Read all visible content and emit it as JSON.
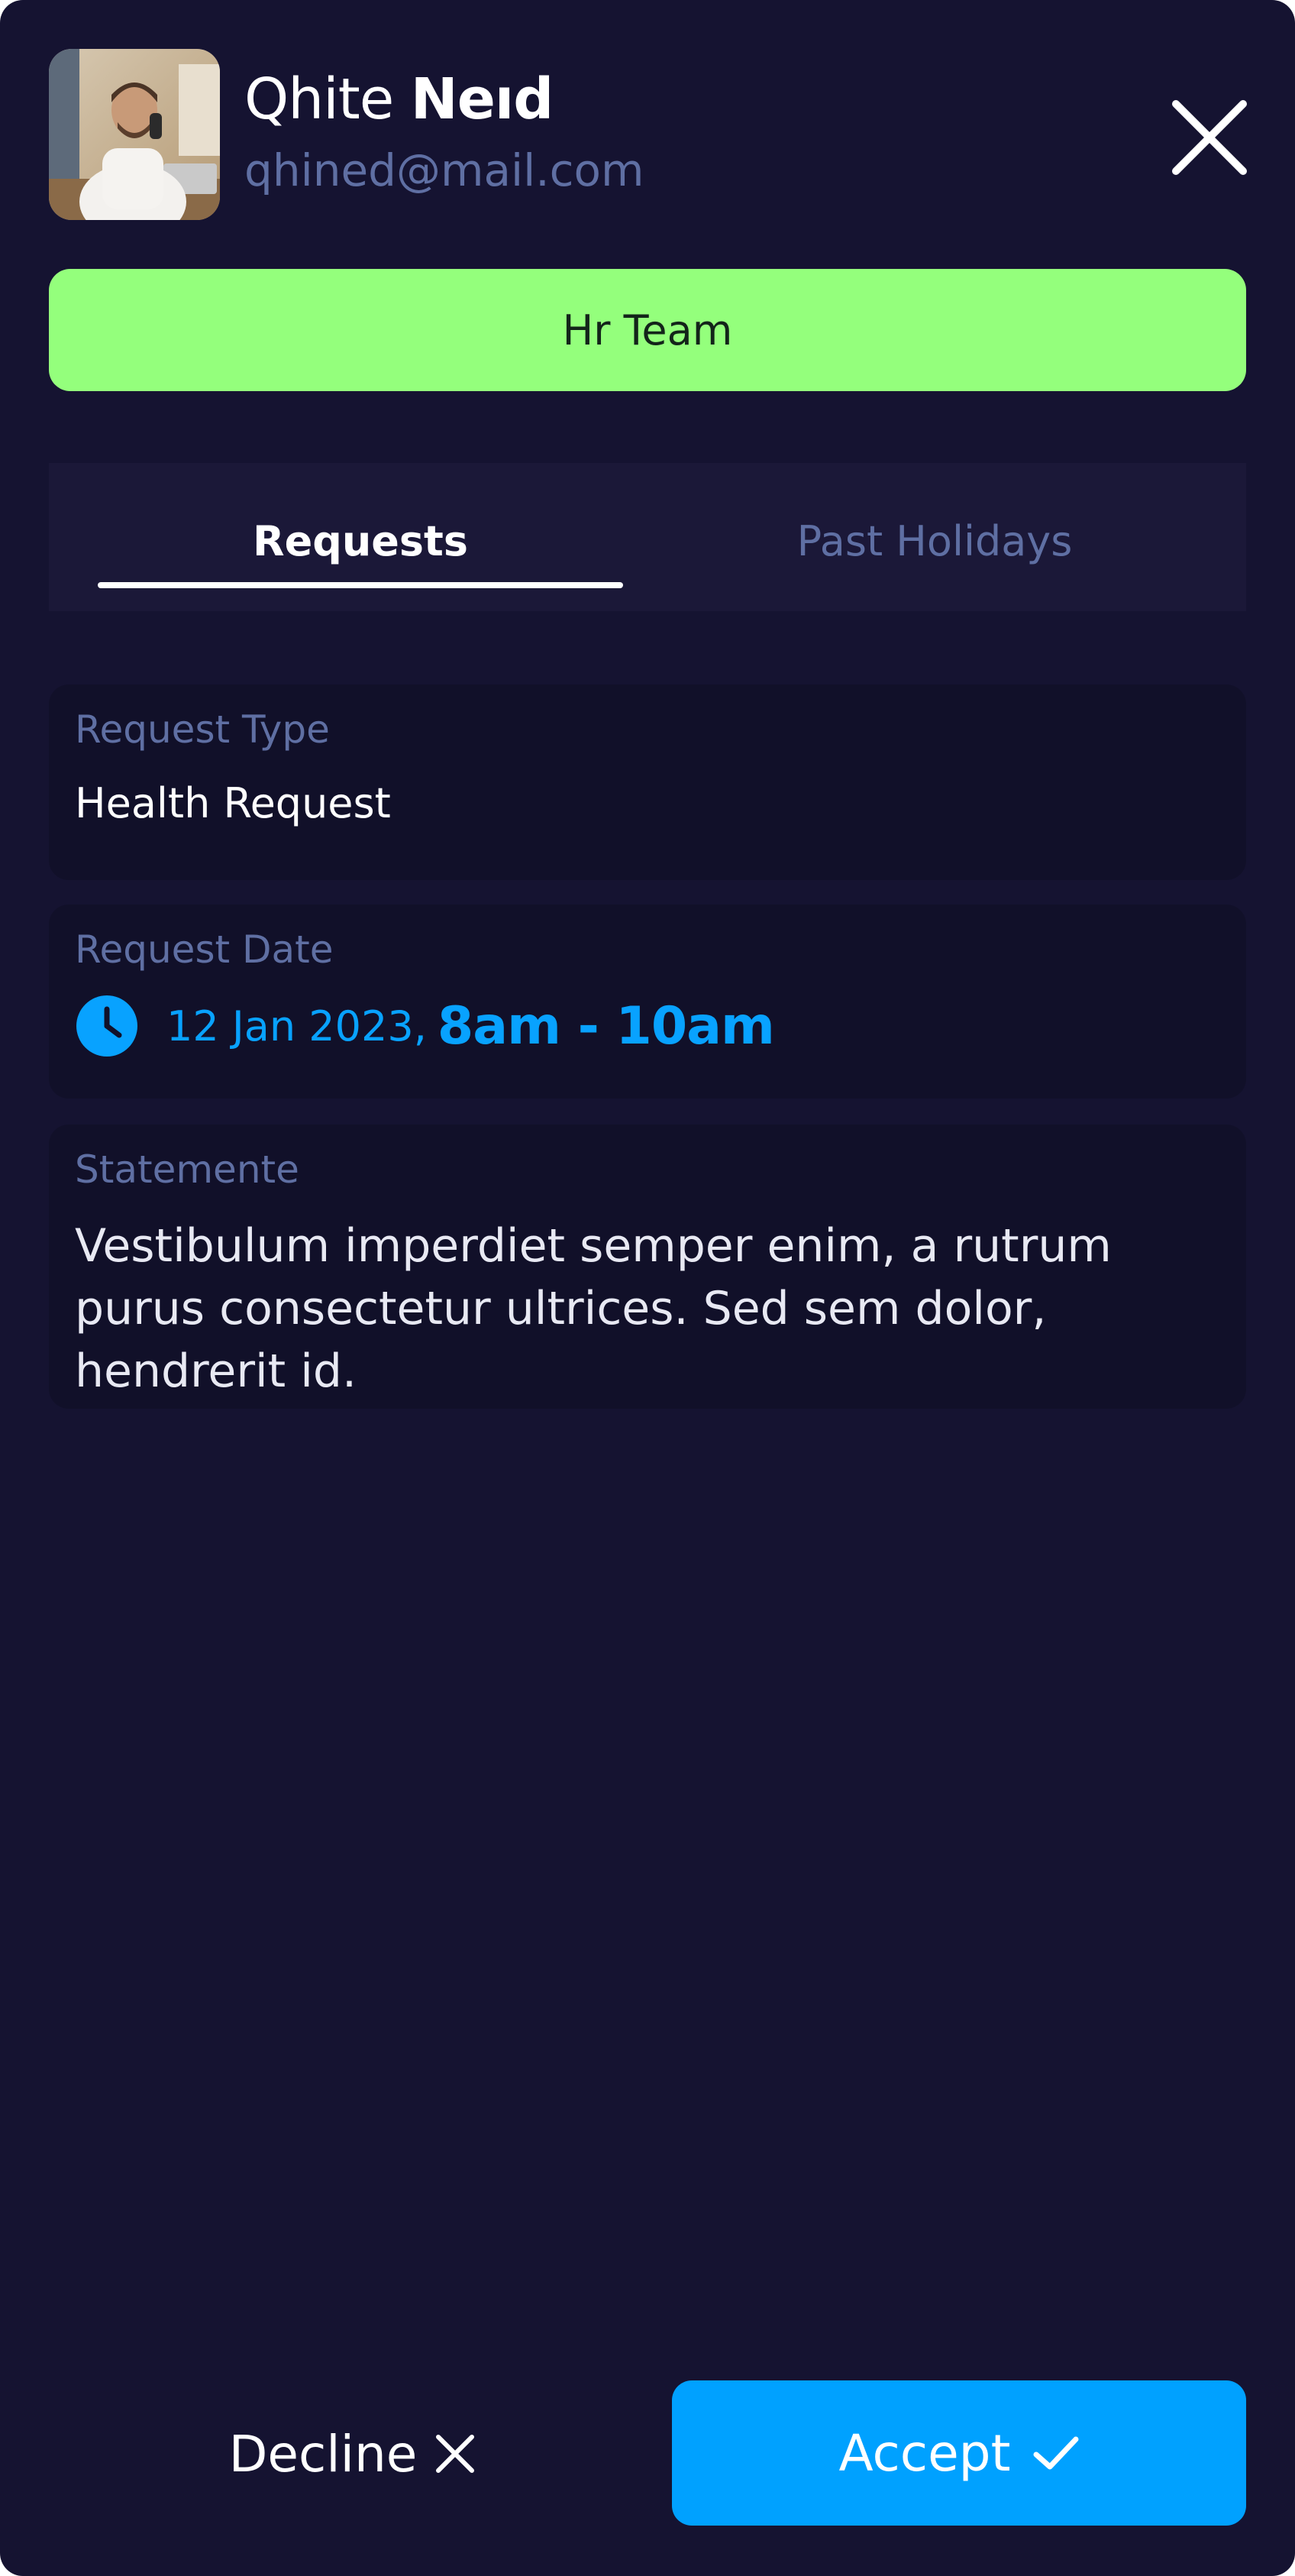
{
  "profile": {
    "first_name": "Qhite",
    "last_name": "Neıd",
    "email": "qhined@mail.com",
    "avatar_icon": "user-photo"
  },
  "team": {
    "label": "Hr Team",
    "color": "#94ff7c"
  },
  "tabs": [
    {
      "label": "Requests",
      "active": true
    },
    {
      "label": "Past Holidays",
      "active": false
    }
  ],
  "request_type": {
    "label": "Request Type",
    "value": "Health Request"
  },
  "request_date": {
    "label": "Request Date",
    "date": "12 Jan 2023,",
    "time": "8am - 10am",
    "icon": "clock-icon"
  },
  "statement": {
    "label": "Statemente",
    "text": "Vestibulum imperdiet semper enim, a rutrum purus consectetur ultrices. Sed sem dolor, hendrerit id."
  },
  "actions": {
    "decline_label": "Decline",
    "accept_label": "Accept",
    "accent": "#00a1ff"
  }
}
